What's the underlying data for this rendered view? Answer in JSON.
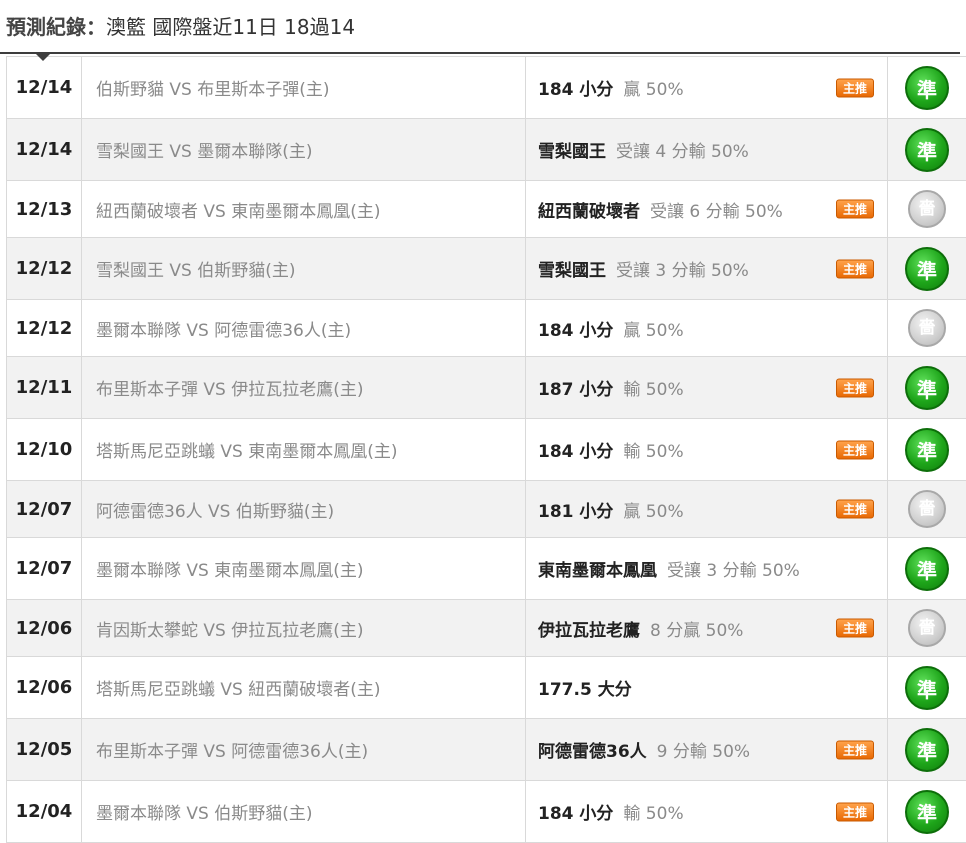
{
  "header": {
    "prefix": "預測紀錄",
    "separator": "：",
    "league": "澳籃",
    "summary": "國際盤近11日 18過14"
  },
  "badge_label": "主推",
  "colors": {
    "hit": "#1ea51a",
    "miss": "#c4c4c4",
    "badge": "#f08a24",
    "header_rule": "#3d3d3d"
  },
  "rows": [
    {
      "date": "12/14",
      "match": "伯斯野貓 VS 布里斯本子彈(主)",
      "pick": "184 小分",
      "detail": "贏 50%",
      "featured": true,
      "result": "準",
      "result_type": "hit"
    },
    {
      "date": "12/14",
      "match": "雪梨國王 VS 墨爾本聯隊(主)",
      "pick": "雪梨國王",
      "detail": "受讓 4 分輸 50%",
      "featured": false,
      "result": "準",
      "result_type": "hit"
    },
    {
      "date": "12/13",
      "match": "紐西蘭破壞者 VS 東南墨爾本鳳凰(主)",
      "pick": "紐西蘭破壞者",
      "detail": "受讓 6 分輸 50%",
      "featured": true,
      "result": "嗇",
      "result_type": "miss"
    },
    {
      "date": "12/12",
      "match": "雪梨國王 VS 伯斯野貓(主)",
      "pick": "雪梨國王",
      "detail": "受讓 3 分輸 50%",
      "featured": true,
      "result": "準",
      "result_type": "hit"
    },
    {
      "date": "12/12",
      "match": "墨爾本聯隊 VS 阿德雷德36人(主)",
      "pick": "184 小分",
      "detail": "贏 50%",
      "featured": false,
      "result": "嗇",
      "result_type": "miss"
    },
    {
      "date": "12/11",
      "match": "布里斯本子彈 VS 伊拉瓦拉老鷹(主)",
      "pick": "187 小分",
      "detail": "輸 50%",
      "featured": true,
      "result": "準",
      "result_type": "hit"
    },
    {
      "date": "12/10",
      "match": "塔斯馬尼亞跳蟻 VS 東南墨爾本鳳凰(主)",
      "pick": "184 小分",
      "detail": "輸 50%",
      "featured": true,
      "result": "準",
      "result_type": "hit"
    },
    {
      "date": "12/07",
      "match": "阿德雷德36人 VS 伯斯野貓(主)",
      "pick": "181 小分",
      "detail": "贏 50%",
      "featured": true,
      "result": "嗇",
      "result_type": "miss"
    },
    {
      "date": "12/07",
      "match": "墨爾本聯隊 VS 東南墨爾本鳳凰(主)",
      "pick": "東南墨爾本鳳凰",
      "detail": "受讓 3 分輸 50%",
      "featured": false,
      "result": "準",
      "result_type": "hit"
    },
    {
      "date": "12/06",
      "match": "肯因斯太攀蛇 VS 伊拉瓦拉老鷹(主)",
      "pick": "伊拉瓦拉老鷹",
      "detail": "8 分贏 50%",
      "featured": true,
      "result": "嗇",
      "result_type": "miss"
    },
    {
      "date": "12/06",
      "match": "塔斯馬尼亞跳蟻 VS 紐西蘭破壞者(主)",
      "pick": "177.5 大分",
      "detail": "",
      "featured": false,
      "result": "準",
      "result_type": "hit"
    },
    {
      "date": "12/05",
      "match": "布里斯本子彈 VS 阿德雷德36人(主)",
      "pick": "阿德雷德36人",
      "detail": "9 分輸 50%",
      "featured": true,
      "result": "準",
      "result_type": "hit"
    },
    {
      "date": "12/04",
      "match": "墨爾本聯隊 VS 伯斯野貓(主)",
      "pick": "184 小分",
      "detail": "輸 50%",
      "featured": true,
      "result": "準",
      "result_type": "hit"
    }
  ]
}
